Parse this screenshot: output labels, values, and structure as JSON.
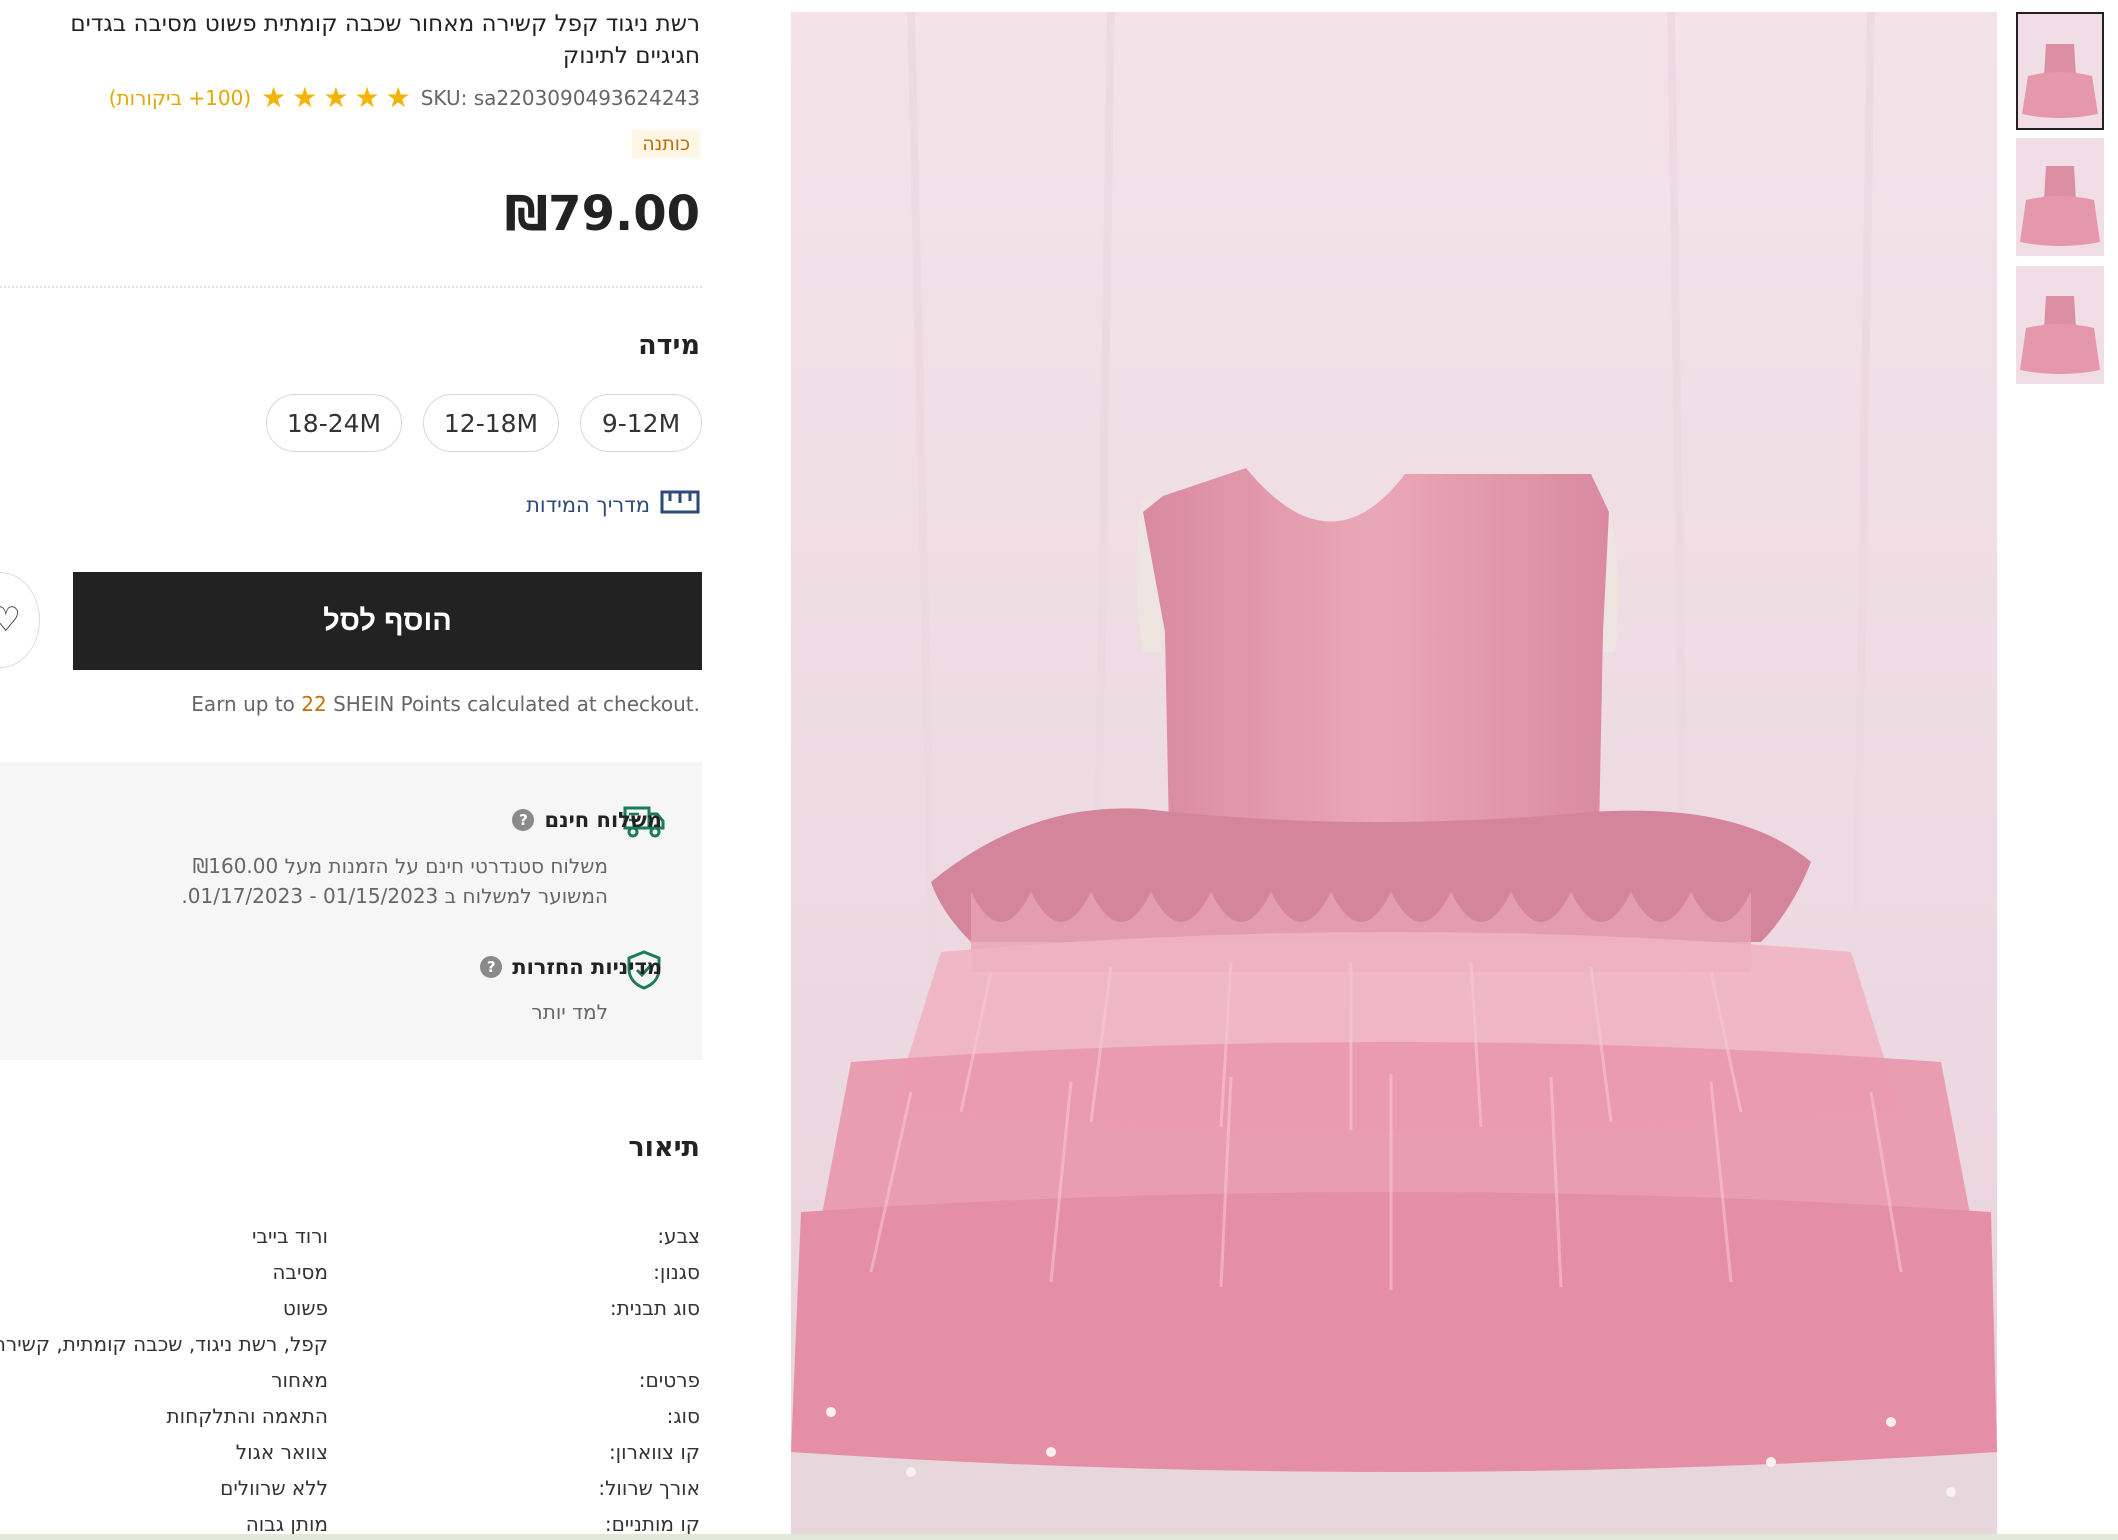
{
  "product": {
    "title": "רשת ניגוד קפל קשירה מאחור שכבה קומתית פשוט מסיבה בגדים חגיגיים לתינוק",
    "sku": "SKU: sa2203090493624243",
    "reviews": "(100+ ביקורות)",
    "rating": 5,
    "badge": "כותנה",
    "price": "₪79.00"
  },
  "size": {
    "heading": "מידה",
    "options": [
      "9-12M",
      "12-18M",
      "18-24M"
    ],
    "guide_label": "מדריך המידות"
  },
  "cart": {
    "add_label": "הוסף לסל",
    "points_prefix": "Earn up to ",
    "points_value": "22",
    "points_suffix": " SHEIN Points calculated at checkout."
  },
  "shipping": {
    "title": "משלוח חינם",
    "line1": "משלוח סטנדרטי חינם על הזמנות מעל ₪160.00",
    "line2": "המשוער למשלוח ב 01/15/2023 - 01/17/2023."
  },
  "returns": {
    "title": "מדיניות החזרות",
    "learn_more": "למד יותר"
  },
  "description": {
    "heading": "תיאור",
    "rows": [
      {
        "key": "צבע:",
        "value": "ורוד בייבי"
      },
      {
        "key": "סגנון:",
        "value": "מסיבה"
      },
      {
        "key": "סוג תבנית:",
        "value": "פשוט"
      },
      {
        "key": "",
        "value": "קפל, רשת ניגוד, שכבה קומתית, קשירה"
      },
      {
        "key": "פרטים:",
        "value": "מאחור"
      },
      {
        "key": "סוג:",
        "value": "התאמה והתלקחות"
      },
      {
        "key": "קו צווארון:",
        "value": "צוואר אגול"
      },
      {
        "key": "אורך שרוול:",
        "value": "ללא שרוולים"
      },
      {
        "key": "קו מותניים:",
        "value": "מותן גבוה"
      }
    ]
  },
  "colors": {
    "price": "#222222",
    "star": "#f5b301",
    "reviews": "#e0a800",
    "badge_bg": "#fff6e6",
    "badge_text": "#c06b00",
    "button_bg": "#222222",
    "link": "#2c4a7c",
    "icon_green": "#1b7a5a",
    "dress_pink": "#e39aae",
    "backdrop": "#f2dfe6"
  },
  "icons": {
    "star": "star-icon",
    "ruler": "ruler-icon",
    "truck": "truck-icon",
    "shield": "shield-check-icon",
    "wishlist": "heart-icon",
    "help": "question-icon"
  }
}
